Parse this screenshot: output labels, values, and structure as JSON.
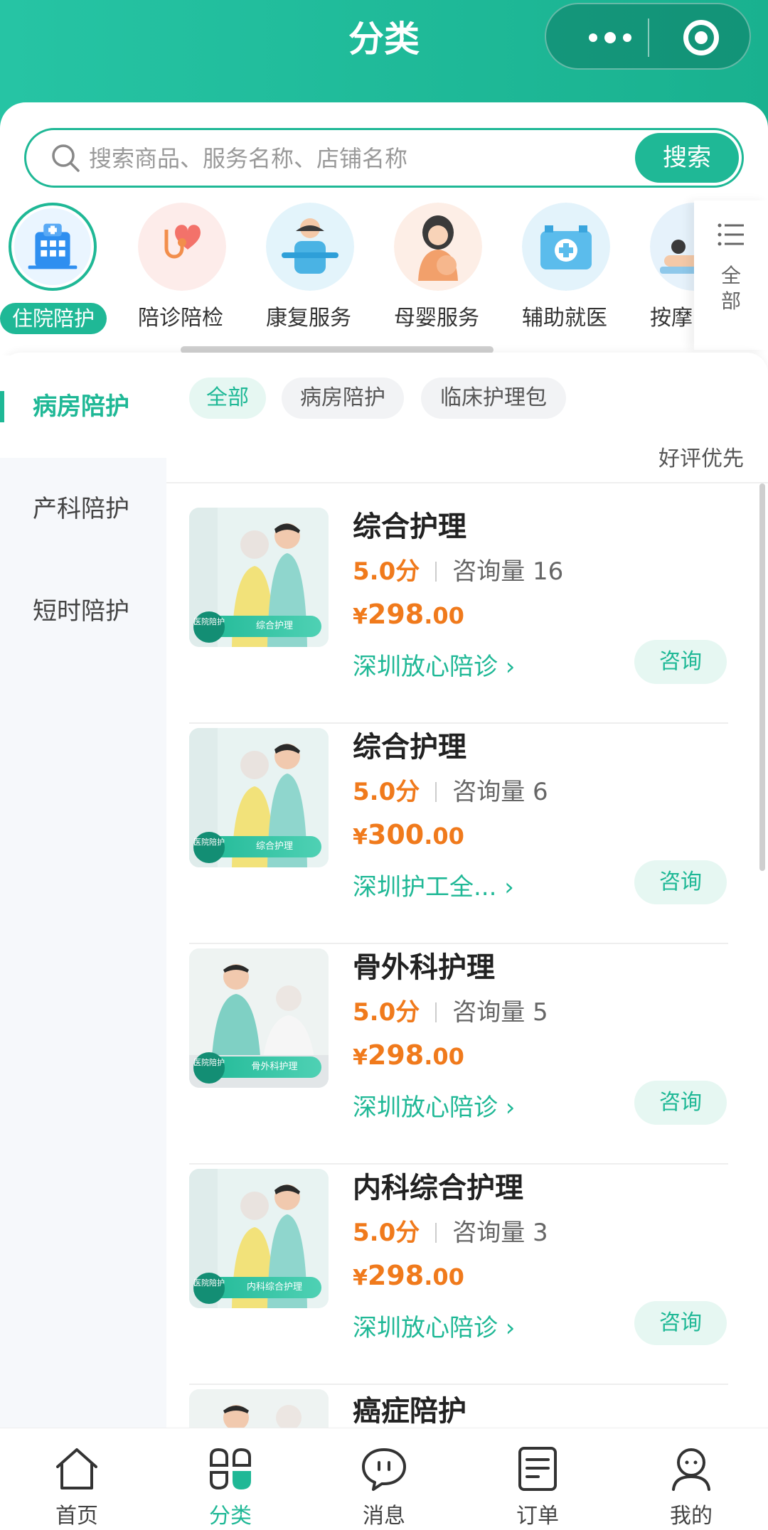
{
  "nav": {
    "title": "分类"
  },
  "search": {
    "placeholder": "搜索商品、服务名称、店铺名称",
    "button": "搜索"
  },
  "categories": [
    {
      "label": "住院陪护",
      "icon": "hospital-icon"
    },
    {
      "label": "陪诊陪检",
      "icon": "stethoscope-heart-icon"
    },
    {
      "label": "康复服务",
      "icon": "rehab-person-icon"
    },
    {
      "label": "母婴服务",
      "icon": "mother-baby-icon"
    },
    {
      "label": "辅助就医",
      "icon": "medical-kit-icon"
    },
    {
      "label": "按摩",
      "icon": "massage-icon"
    }
  ],
  "all_tab": {
    "label_line1": "全",
    "label_line2": "部"
  },
  "sidebar": [
    {
      "label": "病房陪护"
    },
    {
      "label": "产科陪护"
    },
    {
      "label": "短时陪护"
    }
  ],
  "chips": [
    {
      "label": "全部"
    },
    {
      "label": "病房陪护"
    },
    {
      "label": "临床护理包"
    }
  ],
  "sort_label": "好评优先",
  "products": [
    {
      "title": "综合护理",
      "score": "5.0分",
      "consult_count": "咨询量 16",
      "price_symbol": "¥",
      "price_int": "298",
      "price_dec": ".00",
      "shop": "深圳放心陪诊 ›",
      "button": "咨询",
      "badge_a": "医院陪护",
      "badge_b": "综合护理"
    },
    {
      "title": "综合护理",
      "score": "5.0分",
      "consult_count": "咨询量 6",
      "price_symbol": "¥",
      "price_int": "300",
      "price_dec": ".00",
      "shop": "深圳护工全... ›",
      "button": "咨询",
      "badge_a": "医院陪护",
      "badge_b": "综合护理"
    },
    {
      "title": "骨外科护理",
      "score": "5.0分",
      "consult_count": "咨询量 5",
      "price_symbol": "¥",
      "price_int": "298",
      "price_dec": ".00",
      "shop": "深圳放心陪诊 ›",
      "button": "咨询",
      "badge_a": "医院陪护",
      "badge_b": "骨外科护理"
    },
    {
      "title": "内科综合护理",
      "score": "5.0分",
      "consult_count": "咨询量 3",
      "price_symbol": "¥",
      "price_int": "298",
      "price_dec": ".00",
      "shop": "深圳放心陪诊 ›",
      "button": "咨询",
      "badge_a": "医院陪护",
      "badge_b": "内科综合护理"
    },
    {
      "title": "癌症陪护"
    }
  ],
  "tabbar": [
    {
      "label": "首页",
      "icon": "home-icon"
    },
    {
      "label": "分类",
      "icon": "category-icon"
    },
    {
      "label": "消息",
      "icon": "message-icon"
    },
    {
      "label": "订单",
      "icon": "order-icon"
    },
    {
      "label": "我的",
      "icon": "profile-icon"
    }
  ],
  "colors": {
    "accent": "#1fb896",
    "price": "#f07a1c"
  }
}
